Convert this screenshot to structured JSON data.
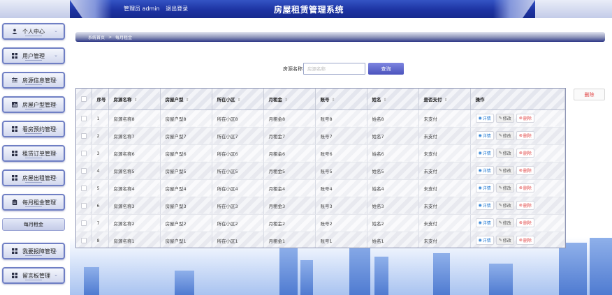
{
  "header": {
    "user_label": "管理员 admin",
    "logout_label": "退出登录",
    "title": "房屋租赁管理系统"
  },
  "sidebar": {
    "items": [
      {
        "label": "个人中心",
        "icon": "user-icon"
      },
      {
        "label": "用户管理",
        "icon": "grid-icon"
      },
      {
        "label": "房源信息管理",
        "icon": "sliders-icon"
      },
      {
        "label": "房屋户型管理",
        "icon": "chart-icon"
      },
      {
        "label": "看房预约管理",
        "icon": "grid-icon"
      },
      {
        "label": "租赁订单管理",
        "icon": "grid-icon"
      },
      {
        "label": "房屋出租管理",
        "icon": "grid-icon"
      },
      {
        "label": "每月租金管理",
        "icon": "clipboard-icon"
      },
      {
        "label": "我要报障管理",
        "icon": "grid-icon"
      },
      {
        "label": "留言板管理",
        "icon": "grid-icon"
      }
    ],
    "sub_item": "每月租金"
  },
  "breadcrumb": {
    "home": "系统首页",
    "sep": ">",
    "current": "每月租金"
  },
  "search": {
    "label": "房源名称",
    "placeholder": "房源名称",
    "button": "查询"
  },
  "batch_delete": "删除",
  "table": {
    "headers": [
      "序号",
      "房源名称",
      "房屋户型",
      "所在小区",
      "月租金",
      "账号",
      "姓名",
      "是否支付",
      "操作"
    ],
    "actions": {
      "detail": "详情",
      "edit": "修改",
      "delete": "删除"
    },
    "rows": [
      {
        "no": "1",
        "name": "房源名称8",
        "type": "房屋户型8",
        "community": "所在小区8",
        "rent": "月租金8",
        "account": "账号8",
        "person": "姓名8",
        "paid": "未支付"
      },
      {
        "no": "2",
        "name": "房源名称7",
        "type": "房屋户型7",
        "community": "所在小区7",
        "rent": "月租金7",
        "account": "账号7",
        "person": "姓名7",
        "paid": "未支付"
      },
      {
        "no": "3",
        "name": "房源名称6",
        "type": "房屋户型6",
        "community": "所在小区6",
        "rent": "月租金6",
        "account": "账号6",
        "person": "姓名6",
        "paid": "未支付"
      },
      {
        "no": "4",
        "name": "房源名称5",
        "type": "房屋户型5",
        "community": "所在小区5",
        "rent": "月租金5",
        "account": "账号5",
        "person": "姓名5",
        "paid": "未支付"
      },
      {
        "no": "5",
        "name": "房源名称4",
        "type": "房屋户型4",
        "community": "所在小区4",
        "rent": "月租金4",
        "account": "账号4",
        "person": "姓名4",
        "paid": "未支付"
      },
      {
        "no": "6",
        "name": "房源名称3",
        "type": "房屋户型3",
        "community": "所在小区3",
        "rent": "月租金3",
        "account": "账号3",
        "person": "姓名3",
        "paid": "未支付"
      },
      {
        "no": "7",
        "name": "房源名称2",
        "type": "房屋户型2",
        "community": "所在小区2",
        "rent": "月租金2",
        "account": "账号2",
        "person": "姓名2",
        "paid": "未支付"
      },
      {
        "no": "8",
        "name": "房源名称1",
        "type": "房屋户型1",
        "community": "所在小区1",
        "rent": "月租金1",
        "account": "账号1",
        "person": "姓名1",
        "paid": "未支付"
      }
    ]
  },
  "colors": {
    "header": "#1d33a2",
    "accent": "#4a52bd",
    "danger": "#e24b4b",
    "detail": "#2b7fd4"
  }
}
